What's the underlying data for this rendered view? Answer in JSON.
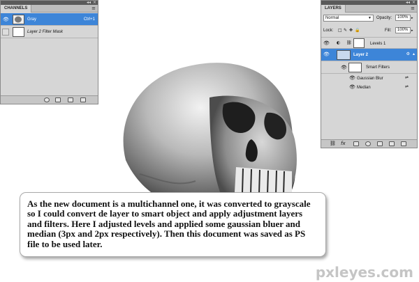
{
  "channels_panel": {
    "tab": "CHANNELS",
    "rows": [
      {
        "name": "Gray",
        "shortcut": "Ctrl+1",
        "selected": true
      },
      {
        "name": "Layer 2 Filter Mask",
        "shortcut": "",
        "selected": false
      }
    ]
  },
  "layers_panel": {
    "tab": "LAYERS",
    "blend_mode": "Normal",
    "opacity_label": "Opacity:",
    "opacity_value": "100%",
    "lock_label": "Lock:",
    "fill_label": "Fill:",
    "fill_value": "100%",
    "layers": [
      {
        "name": "Levels 1"
      },
      {
        "name": "Layer 2"
      },
      {
        "name": "Smart Filters"
      },
      {
        "name": "Gaussian Blur"
      },
      {
        "name": "Median"
      }
    ]
  },
  "caption": {
    "text": "As the new document is a multichannel one, it was converted to grayscale so I could convert de layer to smart object and apply adjustment layers and filters. Here I adjusted levels and applied some gaussian bluer and median (3px and 2px respectively). Then this document was saved as PS file to be used later."
  },
  "watermark": "pxleyes.com",
  "icons": {
    "visibility": "eye-icon",
    "panel_menu": "panel-menu-icon",
    "link": "chain-link-icon",
    "smart_object": "smart-object-icon",
    "filter_options": "filter-options-icon"
  },
  "colors": {
    "selection": "#3d85d8",
    "panel_bg": "#d6d6d6",
    "panel_header": "#5a5a5a"
  }
}
